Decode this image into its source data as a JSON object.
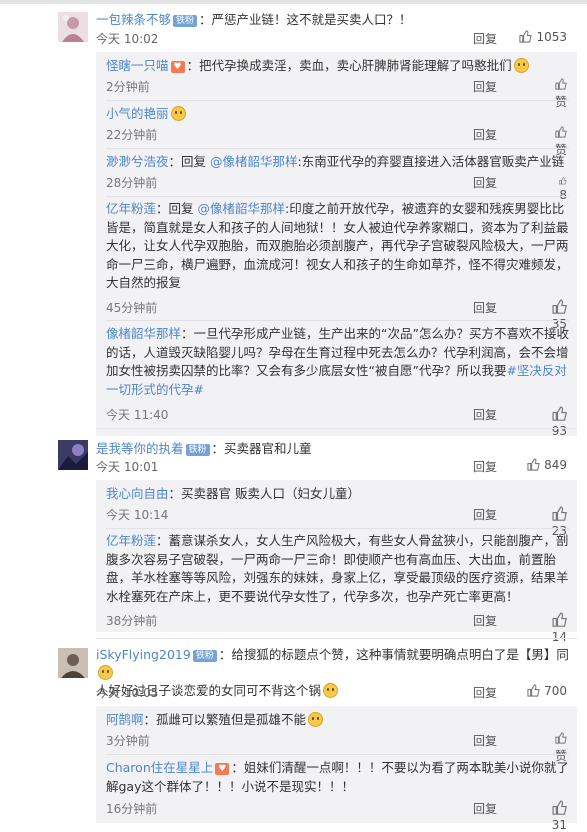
{
  "ui": {
    "reply_label": "回复",
    "like_label": "赞"
  },
  "comments": [
    {
      "user": "一包辣条不够",
      "badge": "铁粉",
      "text": "：严惩产业链！这不就是买卖人口？！",
      "time": "今天 10:02",
      "likes": "1053",
      "replies": [
        {
          "user": "怪瞎一只喵",
          "text": "：把代孕换成卖淫，卖血，卖心肝脾肺肾能理解了吗憨批们",
          "time": "2分钟前",
          "likes": "赞"
        },
        {
          "user": "小气的艳丽",
          "text": "",
          "time": "22分钟前",
          "likes": "赞"
        },
        {
          "user": "渺渺兮浩夜",
          "text": "：回复 ",
          "at": "@像楮韶华那样",
          "text2": ":东南亚代孕的弃婴直接进入活体器官贩卖产业链",
          "time": "28分钟前",
          "likes": "8"
        },
        {
          "user": "亿年粉莲",
          "text": "：回复 ",
          "at": "@像楮韶华那样",
          "text2": ":印度之前开放代孕，被遗弃的女婴和残疾男婴比比皆是，简直就是女人和孩子的人间地狱！！女人被迫代孕养家糊口，资本为了利益最大化，让女人代孕双胞胎，而双胞胎必须剖腹产，再代孕子宫破裂风险极大，一尸两命一尸三命，横尸遍野，血流成河！视女人和孩子的生命如草芥，怪不得灾难频发，大自然的报复",
          "time": "45分钟前",
          "likes": "35"
        },
        {
          "user": "像楮韶华那样",
          "text": "：一旦代孕形成产业链，生产出来的“次品”怎么办？买方不喜欢不接收的话，人道毁灭缺陷婴儿吗？孕母在生育过程中死去怎么办？代孕利润高，会不会增加女性被拐卖囚禁的比率？又会有多少底层女性“被自愿”代孕？所以我要",
          "tag": "#坚决反对一切形式的代孕#",
          "time": "今天 11:40",
          "likes": "93"
        }
      ]
    },
    {
      "user": "是我等你的执着",
      "badge": "铁粉",
      "text": "：买卖器官和儿童",
      "time": "今天 10:01",
      "likes": "849",
      "replies": [
        {
          "user": "我心向自由",
          "text": "：买卖器官 贩卖人口（妇女儿童）",
          "time": "今天 10:14",
          "likes": "23"
        },
        {
          "user": "亿年粉莲",
          "text": "：蓄意谋杀女人，女人生产风险极大，有些女人骨盆狭小，只能剖腹产，剖腹多次容易子宫破裂，一尸两命一尸三命！即使顺产也有高血压、大出血，前置胎盘，羊水栓塞等等风险，刘强东的妹妹，身家上亿，享受最顶级的医疗资源，结果羊水栓塞死在产床上，更不要说代孕女性了，代孕多次，也孕产死亡率更高！",
          "time": "38分钟前",
          "likes": "14"
        }
      ]
    },
    {
      "user": "iSkyFlying2019",
      "badge": "铁粉",
      "text": "：给搜狐的标题点个赞，这种事情就要明确点明白了是【男】同",
      "text2": "人好好过日子谈恋爱的女同可不背这个锅",
      "time": "今天 10:05",
      "likes": "700",
      "replies": [
        {
          "user": "阿鹄啊",
          "text": "：孤雌可以繁殖但是孤雄不能",
          "time": "3分钟前",
          "likes": "赞"
        },
        {
          "user": "Charon住在星星上",
          "text": "：姐妹们清醒一点啊！！！不要以为看了两本耽美小说你就了解gay这个群体了！！！小说不是现实！！！",
          "time": "16分钟前",
          "likes": "31"
        }
      ]
    }
  ]
}
